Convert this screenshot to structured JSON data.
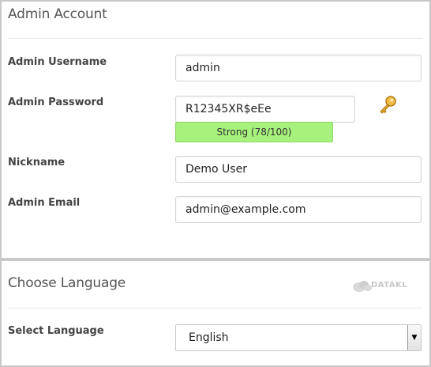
{
  "admin_account": {
    "title": "Admin Account",
    "username_label": "Admin Username",
    "username_value": "admin",
    "password_label": "Admin Password",
    "password_value": "R12345XR$eEe",
    "password_strength": "Strong (78/100)",
    "nickname_label": "Nickname",
    "nickname_value": "Demo User",
    "email_label": "Admin Email",
    "email_value": "admin@example.com"
  },
  "language": {
    "title": "Choose Language",
    "select_label": "Select Language",
    "selected": "English",
    "logo_text": "DATAKL"
  },
  "colors": {
    "strength_bg": "#a7f27c",
    "key_icon": "#e0a632"
  }
}
